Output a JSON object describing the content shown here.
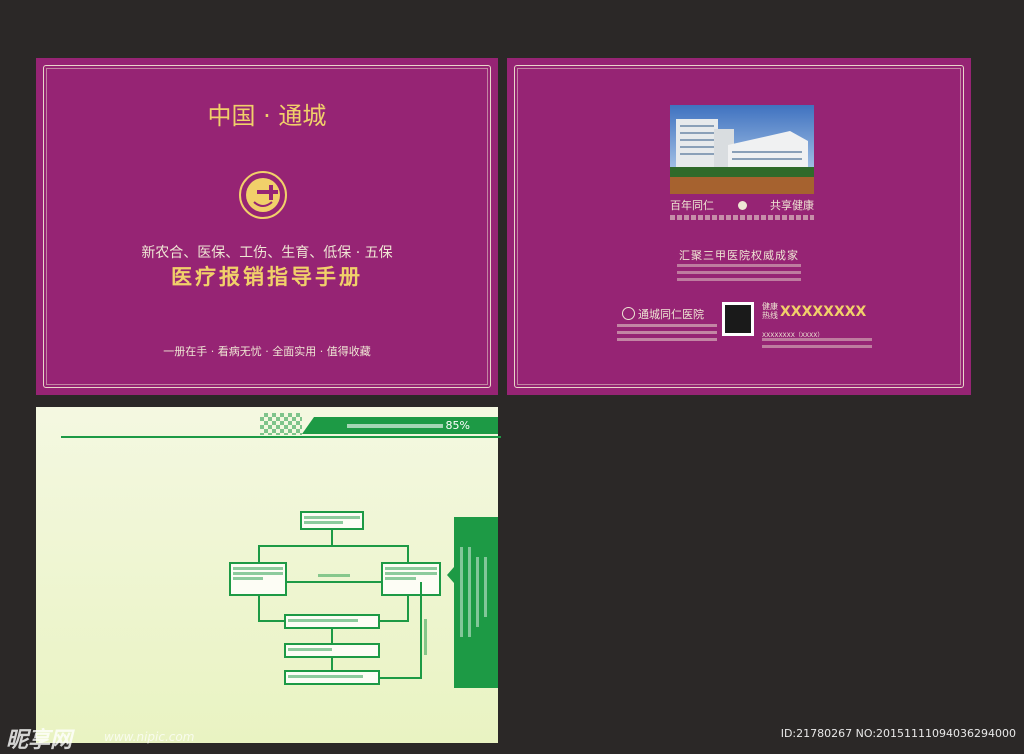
{
  "front_cover": {
    "title": "中国 · 通城",
    "line1": "新农合、医保、工伤、生育、低保 · 五保",
    "main_title": "医疗报销指导手册",
    "slogan": "一册在手 · 看病无忧 · 全面实用 · 值得收藏"
  },
  "back_cover": {
    "slogan_left": "百年同仁",
    "slogan_right": "共享健康",
    "sub_slogan": "汇聚三甲医院权威成家",
    "hospital_name": "通城同仁医院",
    "hotline_label_1": "健康",
    "hotline_label_2": "热线",
    "hotline_number": "XXXXXXXX",
    "phone_line": "XXXXXXXX（XXXX）"
  },
  "inner_page": {
    "header_text": "85%"
  },
  "watermark": {
    "logo": "昵享网",
    "url": "www.nipic.com",
    "id_text": "ID:21780267 NO:20151111094036294000"
  },
  "colors": {
    "purple": "#962474",
    "gold": "#f1d06a",
    "green": "#1d9a45",
    "background": "#2b2827"
  }
}
